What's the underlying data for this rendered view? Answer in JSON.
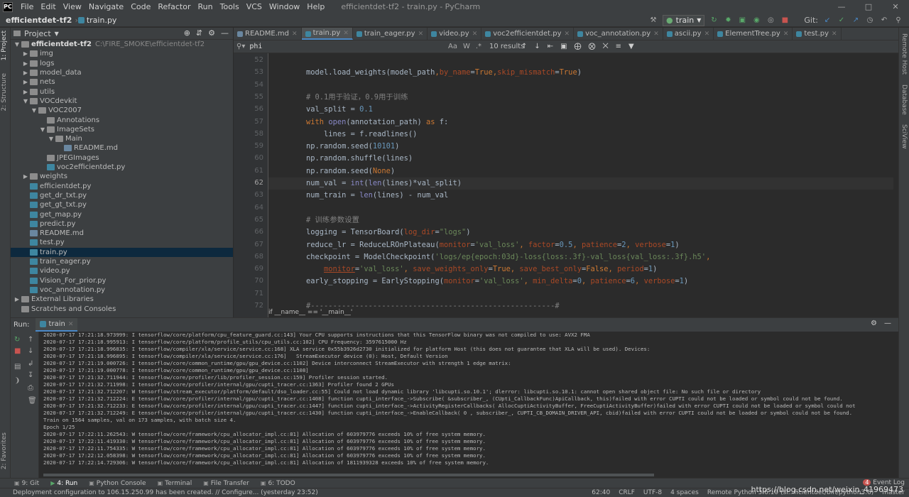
{
  "app": {
    "window_title": "efficientdet-tf2 - train.py - PyCharm",
    "menu": [
      "File",
      "Edit",
      "View",
      "Navigate",
      "Code",
      "Refactor",
      "Run",
      "Tools",
      "VCS",
      "Window",
      "Help"
    ],
    "logo_text": "PC"
  },
  "nav": {
    "project_crumb": "efficientdet-tf2",
    "file_crumb": "train.py",
    "run_config": "train",
    "git_label": "Git:"
  },
  "side_tabs": {
    "left_top": [
      "1: Project",
      "2: Structure"
    ],
    "left_bottom": [
      "2: Favorites"
    ],
    "right": [
      "Remote Host",
      "Database",
      "SciView"
    ]
  },
  "project_panel": {
    "title": "Project",
    "root": {
      "label": "efficientdet-tf2",
      "path": "C:\\FIRE_SMOKE\\efficientdet-tf2"
    },
    "items": [
      {
        "label": "img",
        "type": "folder",
        "depth": 1,
        "arrow": "▶"
      },
      {
        "label": "logs",
        "type": "folder",
        "depth": 1,
        "arrow": "▶"
      },
      {
        "label": "model_data",
        "type": "folder",
        "depth": 1,
        "arrow": "▶"
      },
      {
        "label": "nets",
        "type": "folder",
        "depth": 1,
        "arrow": "▶"
      },
      {
        "label": "utils",
        "type": "folder",
        "depth": 1,
        "arrow": "▶"
      },
      {
        "label": "VOCdevkit",
        "type": "folder",
        "depth": 1,
        "arrow": "▼"
      },
      {
        "label": "VOC2007",
        "type": "folder",
        "depth": 2,
        "arrow": "▼"
      },
      {
        "label": "Annotations",
        "type": "folder",
        "depth": 3,
        "arrow": ""
      },
      {
        "label": "ImageSets",
        "type": "folder",
        "depth": 3,
        "arrow": "▼"
      },
      {
        "label": "Main",
        "type": "folder",
        "depth": 4,
        "arrow": "▼"
      },
      {
        "label": "README.md",
        "type": "md",
        "depth": 5,
        "arrow": ""
      },
      {
        "label": "JPEGImages",
        "type": "folder",
        "depth": 3,
        "arrow": ""
      },
      {
        "label": "voc2efficientdet.py",
        "type": "py",
        "depth": 3,
        "arrow": ""
      },
      {
        "label": "weights",
        "type": "folder",
        "depth": 1,
        "arrow": "▶"
      },
      {
        "label": "efficientdet.py",
        "type": "py",
        "depth": 1,
        "arrow": ""
      },
      {
        "label": "get_dr_txt.py",
        "type": "py",
        "depth": 1,
        "arrow": ""
      },
      {
        "label": "get_gt_txt.py",
        "type": "py",
        "depth": 1,
        "arrow": ""
      },
      {
        "label": "get_map.py",
        "type": "py",
        "depth": 1,
        "arrow": ""
      },
      {
        "label": "predict.py",
        "type": "py",
        "depth": 1,
        "arrow": ""
      },
      {
        "label": "README.md",
        "type": "md",
        "depth": 1,
        "arrow": ""
      },
      {
        "label": "test.py",
        "type": "py",
        "depth": 1,
        "arrow": ""
      },
      {
        "label": "train.py",
        "type": "py",
        "depth": 1,
        "arrow": "",
        "selected": true
      },
      {
        "label": "train_eager.py",
        "type": "py",
        "depth": 1,
        "arrow": ""
      },
      {
        "label": "video.py",
        "type": "py",
        "depth": 1,
        "arrow": ""
      },
      {
        "label": "Vision_For_prior.py",
        "type": "py",
        "depth": 1,
        "arrow": ""
      },
      {
        "label": "voc_annotation.py",
        "type": "py",
        "depth": 1,
        "arrow": ""
      },
      {
        "label": "External Libraries",
        "type": "folder",
        "depth": 0,
        "arrow": "▶"
      },
      {
        "label": "Scratches and Consoles",
        "type": "folder",
        "depth": 0,
        "arrow": ""
      }
    ]
  },
  "editor_tabs": [
    {
      "label": "README.md",
      "kind": "md"
    },
    {
      "label": "train.py",
      "kind": "py",
      "active": true
    },
    {
      "label": "train_eager.py",
      "kind": "py"
    },
    {
      "label": "video.py",
      "kind": "py"
    },
    {
      "label": "voc2efficientdet.py",
      "kind": "py"
    },
    {
      "label": "voc_annotation.py",
      "kind": "py"
    },
    {
      "label": "ascii.py",
      "kind": "py"
    },
    {
      "label": "ElementTree.py",
      "kind": "py"
    },
    {
      "label": "test.py",
      "kind": "py"
    }
  ],
  "find_bar": {
    "query": "phi",
    "results": "10 results",
    "case_label": "Aa",
    "word_label": "W",
    "regex_label": ".*"
  },
  "code": {
    "current_line": 62,
    "lines": [
      {
        "n": 52,
        "html": ""
      },
      {
        "n": 53,
        "html": "    model.load_weights(model_path<span class=\"kw\">,</span><span class=\"pa\">by_name</span>=<span class=\"kw\">True</span><span class=\"kw\">,</span><span class=\"pa\">skip_mismatch</span>=<span class=\"kw\">True</span>)"
      },
      {
        "n": 54,
        "html": ""
      },
      {
        "n": 55,
        "html": "    <span class=\"cm\"># 0.1用于验证，0.9用于训练</span>"
      },
      {
        "n": 56,
        "html": "    val_split = <span class=\"nu\">0.1</span>"
      },
      {
        "n": 57,
        "html": "    <span class=\"kw\">with</span> <span class=\"bi\">open</span>(annotation_path) <span class=\"kw\">as</span> f:"
      },
      {
        "n": 58,
        "html": "        lines = f.readlines()"
      },
      {
        "n": 59,
        "html": "    np.random.seed(<span class=\"nu\">10101</span>)"
      },
      {
        "n": 60,
        "html": "    np.random.shuffle(lines)"
      },
      {
        "n": 61,
        "html": "    np.random.seed(<span class=\"kw\">None</span>)"
      },
      {
        "n": 62,
        "html": "    num_val = <span class=\"bi\">int</span>(<span class=\"bi\">len</span>(lines)*val_split)"
      },
      {
        "n": 63,
        "html": "    num_train = <span class=\"bi\">len</span>(lines) - num_val"
      },
      {
        "n": 64,
        "html": ""
      },
      {
        "n": 65,
        "html": "    <span class=\"cm\"># 训练参数设置</span>"
      },
      {
        "n": 66,
        "html": "    logging = TensorBoard(<span class=\"pa\">log_dir</span>=<span class=\"st\">\"logs\"</span>)"
      },
      {
        "n": 67,
        "html": "    reduce_lr = ReduceLROnPlateau(<span class=\"pa\">monitor</span>=<span class=\"st\">'val_loss'</span><span class=\"kw\">,</span> <span class=\"pa\">factor</span>=<span class=\"nu\">0.5</span><span class=\"kw\">,</span> <span class=\"pa\">patience</span>=<span class=\"nu\">2</span><span class=\"kw\">,</span> <span class=\"pa\">verbose</span>=<span class=\"nu\">1</span>)"
      },
      {
        "n": 68,
        "html": "    checkpoint = ModelCheckpoint(<span class=\"st\">'logs/ep{epoch:03d}-loss{loss:.3f}-val_loss{val_loss:.3f}.h5'</span><span class=\"kw\">,</span>"
      },
      {
        "n": 69,
        "html": "        <span class=\"pa und\">monitor</span>=<span class=\"st\">'val_loss'</span><span class=\"kw\">,</span> <span class=\"pa\">save_weights_only</span>=<span class=\"kw\">True</span><span class=\"kw\">,</span> <span class=\"pa\">save_best_only</span>=<span class=\"kw\">False</span><span class=\"kw\">,</span> <span class=\"pa\">period</span>=<span class=\"nu\">1</span>)"
      },
      {
        "n": 70,
        "html": "    early_stopping = EarlyStopping(<span class=\"pa\">monitor</span>=<span class=\"st\">'val_loss'</span><span class=\"kw\">,</span> <span class=\"pa\">min_delta</span>=<span class=\"nu\">0</span><span class=\"kw\">,</span> <span class=\"pa\">patience</span>=<span class=\"nu\">6</span><span class=\"kw\">,</span> <span class=\"pa\">verbose</span>=<span class=\"nu\">1</span>)"
      },
      {
        "n": 71,
        "html": ""
      },
      {
        "n": 72,
        "html": "    <span class=\"cm\">#-------------------------------------------------------#</span>"
      }
    ]
  },
  "editor_breadcrumb": "if __name__ == '__main__'",
  "run_panel": {
    "label": "Run:",
    "tab": "train",
    "console": [
      "2020-07-17 17:21:18.973999: I tensorflow/core/platform/cpu_feature_guard.cc:143] Your CPU supports instructions that this TensorFlow binary was not compiled to use: AVX2 FMA",
      "2020-07-17 17:21:18.995913: I tensorflow/core/platform/profile_utils/cpu_utils.cc:102] CPU Frequency: 3597615000 Hz",
      "2020-07-17 17:21:18.996835: I tensorflow/compiler/xla/service/service.cc:168] XLA service 0x55b3926d2730 initialized for platform Host (this does not guarantee that XLA will be used). Devices:",
      "2020-07-17 17:21:18.996895: I tensorflow/compiler/xla/service/service.cc:176]   StreamExecutor device (0): Host, Default Version",
      "2020-07-17 17:21:19.000726: I tensorflow/core/common_runtime/gpu/gpu_device.cc:1102] Device interconnect StreamExecutor with strength 1 edge matrix:",
      "2020-07-17 17:21:19.000778: I tensorflow/core/common_runtime/gpu/gpu_device.cc:1108]",
      "2020-07-17 17:21:32.711944: I tensorflow/core/profiler/lib/profiler_session.cc:159] Profiler session started.",
      "2020-07-17 17:21:32.711998: I tensorflow/core/profiler/internal/gpu/cupti_tracer.cc:1363] Profiler found 2 GPUs",
      "2020-07-17 17:21:32.712207: W tensorflow/stream_executor/platform/default/dso_loader.cc:55] Could not load dynamic library 'libcupti.so.10.1'; dlerror: libcupti.so.10.1: cannot open shared object file: No such file or directory",
      "2020-07-17 17:21:32.712224: E tensorflow/core/profiler/internal/gpu/cupti_tracer.cc:1408] function cupti_interface_->Subscribe( &subscriber_, (CUpti_CallbackFunc)ApiCallback, this)failed with error CUPTI could not be loaded or symbol could not be found.",
      "2020-07-17 17:21:32.712233: E tensorflow/core/profiler/internal/gpu/cupti_tracer.cc:1447] function cupti_interface_->ActivityRegisterCallbacks( AllocCuptiActivityBuffer, FreeCuptiActivityBuffer)failed with error CUPTI could not be loaded or symbol could not",
      "2020-07-17 17:21:32.712249: E tensorflow/core/profiler/internal/gpu/cupti_tracer.cc:1430] function cupti_interface_->EnableCallback( 0 , subscriber_, CUPTI_CB_DOMAIN_DRIVER_API, cbid)failed with error CUPTI could not be loaded or symbol could not be found.",
      "Train on 1564 samples, val on 173 samples, with batch size 4.",
      "Epoch 1/25",
      "2020-07-17 17:22:11.262543: W tensorflow/core/framework/cpu_allocator_impl.cc:81] Allocation of 603979776 exceeds 10% of free system memory.",
      "2020-07-17 17:22:11.419330: W tensorflow/core/framework/cpu_allocator_impl.cc:81] Allocation of 603979776 exceeds 10% of free system memory.",
      "2020-07-17 17:22:11.754335: W tensorflow/core/framework/cpu_allocator_impl.cc:81] Allocation of 603979776 exceeds 10% of free system memory.",
      "2020-07-17 17:22:12.058398: W tensorflow/core/framework/cpu_allocator_impl.cc:81] Allocation of 603979776 exceeds 10% of free system memory.",
      "2020-07-17 17:22:14.729306: W tensorflow/core/framework/cpu_allocator_impl.cc:81] Allocation of 1811939328 exceeds 10% of free system memory."
    ]
  },
  "bottom_tabs": [
    {
      "label": "9: Git",
      "icon": "git-icon"
    },
    {
      "label": "4: Run",
      "icon": "run-icon",
      "active": true
    },
    {
      "label": "Python Console",
      "icon": "python-console-icon"
    },
    {
      "label": "Terminal",
      "icon": "terminal-icon"
    },
    {
      "label": "File Transfer",
      "icon": "file-transfer-icon"
    },
    {
      "label": "6: TODO",
      "icon": "todo-icon"
    }
  ],
  "event_log": {
    "count": "4",
    "label": "Event Log"
  },
  "status": {
    "message": "Deployment configuration to 106.15.250.99 has been created. // Configure... (yesterday 23:52)",
    "position": "62:40",
    "line_sep": "CRLF",
    "encoding": "UTF-8",
    "indent": "4 spaces",
    "interpreter": "Remote Python 3.6.10 (sf...ficientdet/bin/python3.6)",
    "branch": "master"
  },
  "watermark": "https://blog.csdn.net/weixin_41969473",
  "colors": {
    "accent": "#4a88c7",
    "bg": "#2b2b2b",
    "panel": "#3c3f41"
  }
}
